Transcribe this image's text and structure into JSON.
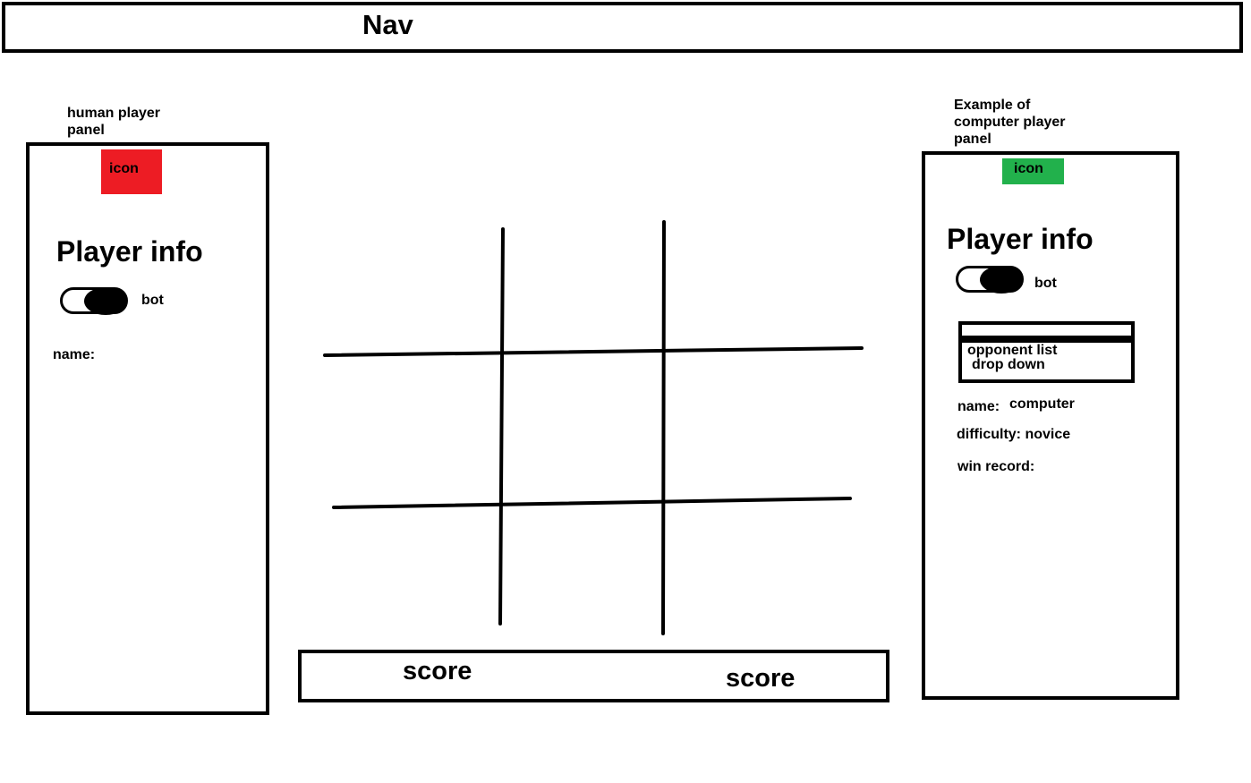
{
  "nav": {
    "title": "Nav"
  },
  "left_panel": {
    "caption_line1": "human player",
    "caption_line2": "panel",
    "icon_label": "icon",
    "icon_color": "#ed1c24",
    "heading": "Player info",
    "toggle_label": "bot",
    "name_label": "name:"
  },
  "right_panel": {
    "caption_line1": "Example of",
    "caption_line2": "computer player",
    "caption_line3": "panel",
    "icon_label": "icon",
    "icon_color": "#22b14c",
    "heading": "Player info",
    "toggle_label": "bot",
    "dropdown_line1": "opponent list",
    "dropdown_line2": "drop down",
    "name_label": "name:",
    "name_value": "computer",
    "difficulty_text": "difficulty: novice",
    "win_record_label": "win record:"
  },
  "score_bar": {
    "left_label": "score",
    "right_label": "score"
  }
}
